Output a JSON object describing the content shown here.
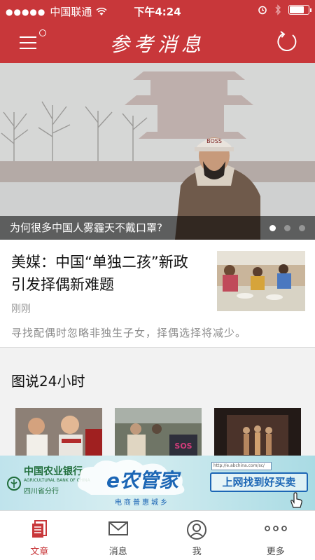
{
  "status_bar": {
    "carrier": "中国联通",
    "time": "下午4:24",
    "battery_level": 0.85
  },
  "nav": {
    "logo": "参考消息",
    "menu_icon": "menu-icon",
    "refresh_icon": "refresh-icon"
  },
  "hero": {
    "caption": "为何很多中国人雾霾天不戴口罩?",
    "pages": 3,
    "active_page": 1
  },
  "article": {
    "title": "美媒：中国“单独二孩”新政引发择偶新难题",
    "time": "刚刚",
    "summary": "寻找配偶时忽略非独生子女，择偶选择将减少。"
  },
  "photo_section": {
    "title": "图说24小时"
  },
  "ad": {
    "bank_name": "中国农业银行",
    "bank_name_en": "AGRICULTURAL BANK OF CHINA",
    "bank_branch": "四川省分行",
    "brand": "e农管家",
    "slogan": "电商普惠城乡",
    "url": "http://e.abchina.com/sc/",
    "cta": "上网找到好买卖"
  },
  "tabbar": {
    "items": [
      {
        "label": "文章",
        "icon": "article-icon",
        "active": true
      },
      {
        "label": "消息",
        "icon": "mail-icon",
        "active": false
      },
      {
        "label": "我",
        "icon": "user-icon",
        "active": false
      },
      {
        "label": "更多",
        "icon": "more-icon",
        "active": false
      }
    ]
  },
  "colors": {
    "brand_red": "#c8373a",
    "ad_blue": "#1c66b5",
    "ad_green": "#1f6d3a"
  }
}
